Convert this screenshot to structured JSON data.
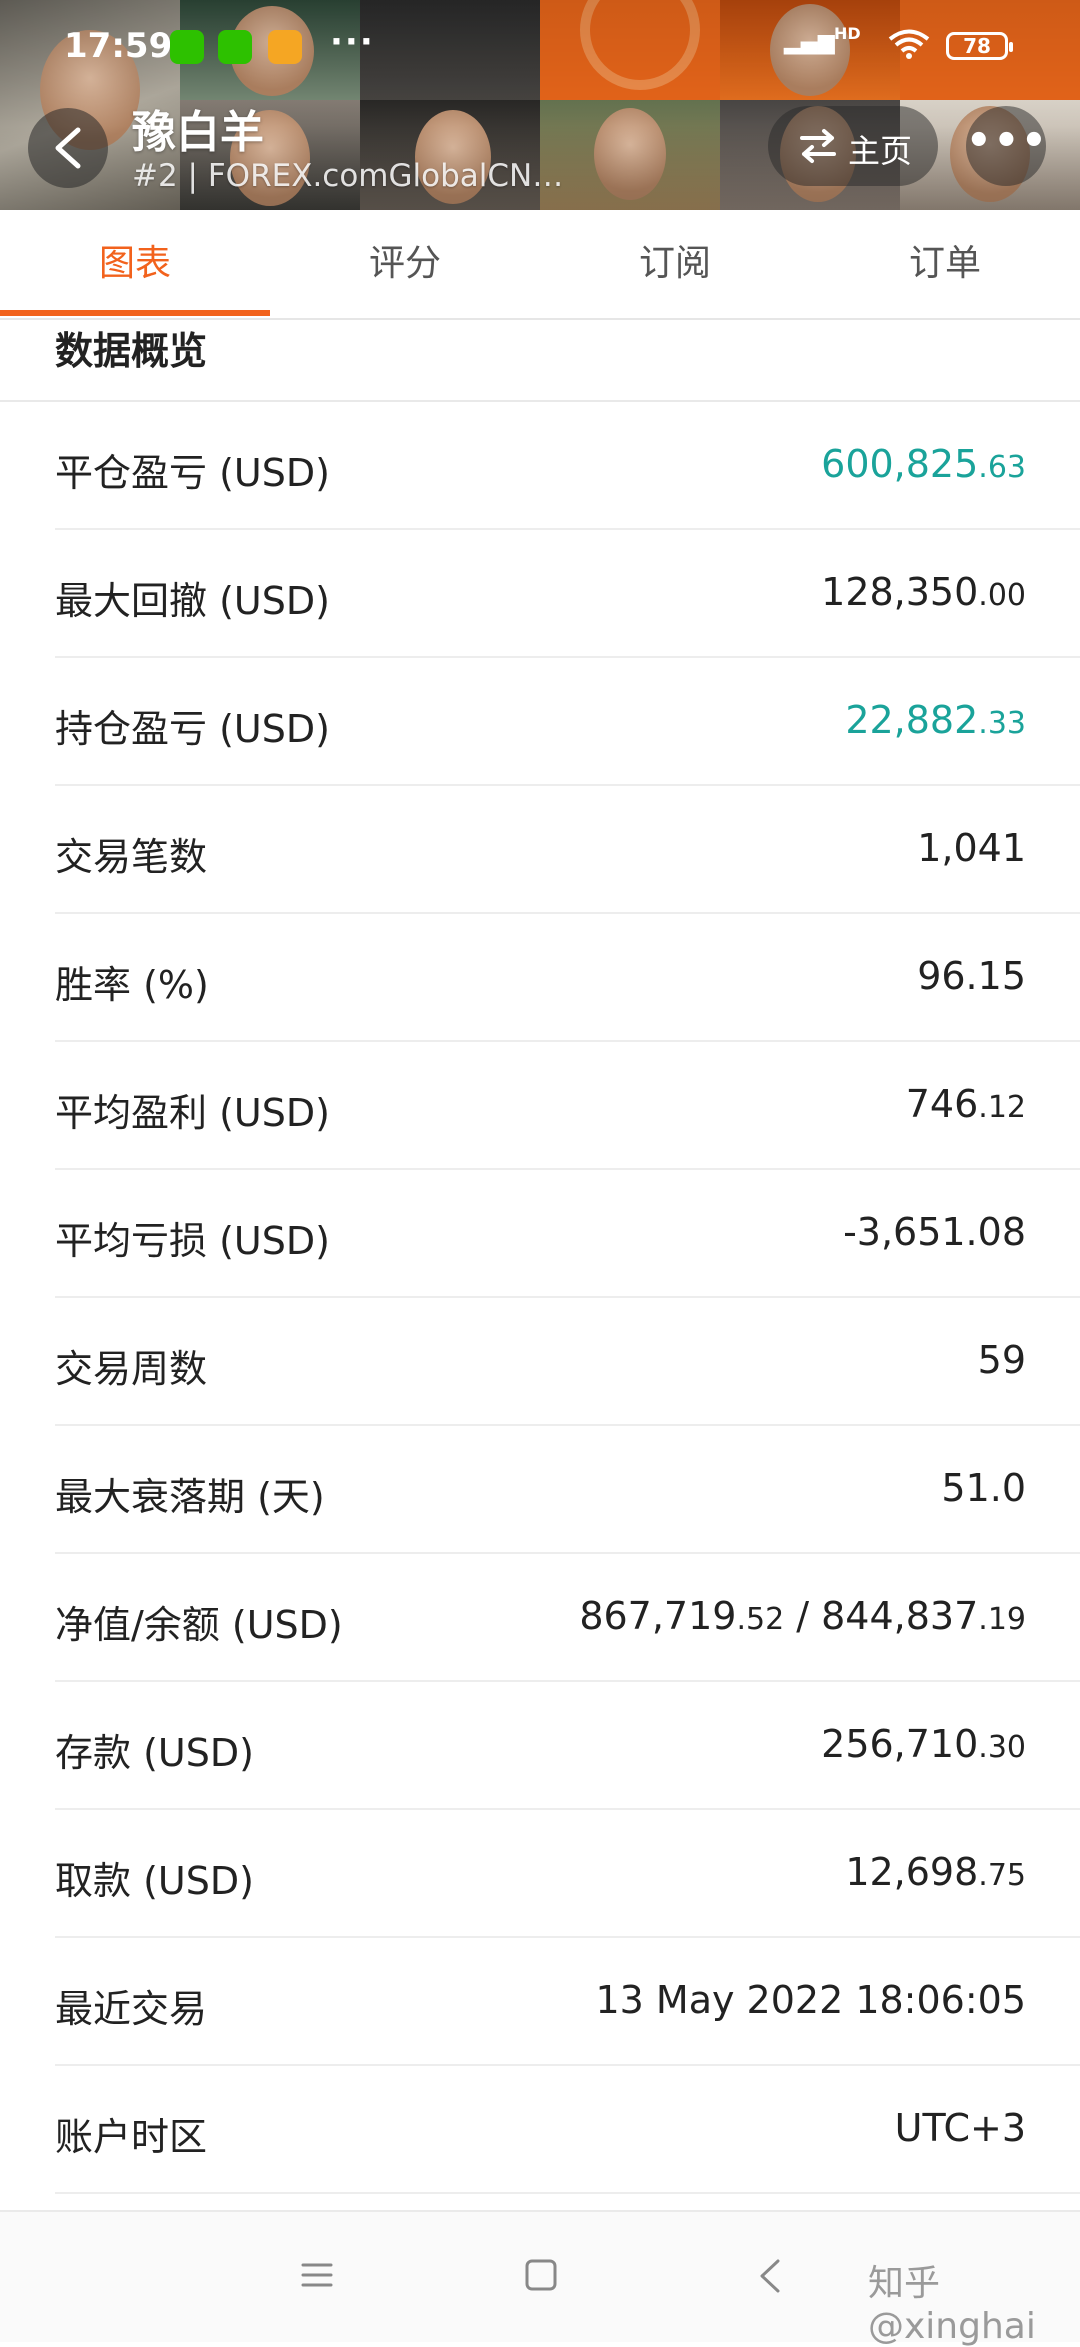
{
  "status_bar": {
    "time": "17:59",
    "more": "···",
    "signal_label": "HD",
    "battery": "78"
  },
  "header": {
    "title": "豫白羊",
    "subtitle": "#2 | FOREX.comGlobalCN…",
    "home_label": "主页",
    "more": "•••"
  },
  "tabs": [
    {
      "label": "图表",
      "active": true
    },
    {
      "label": "评分",
      "active": false
    },
    {
      "label": "订阅",
      "active": false
    },
    {
      "label": "订单",
      "active": false
    }
  ],
  "section": {
    "title": "数据概览"
  },
  "stats": [
    {
      "label": "平仓盈亏 (USD)",
      "int": "600,825",
      "dec": ".63",
      "positive": true
    },
    {
      "label": "最大回撤 (USD)",
      "int": "128,350",
      "dec": ".00",
      "positive": false
    },
    {
      "label": "持仓盈亏 (USD)",
      "int": "22,882",
      "dec": ".33",
      "positive": true
    },
    {
      "label": "交易笔数",
      "int": "1,041",
      "dec": "",
      "positive": false
    },
    {
      "label": "胜率 (%)",
      "int": "96.15",
      "dec": "",
      "positive": false
    },
    {
      "label": "平均盈利 (USD)",
      "int": "746",
      "dec": ".12",
      "positive": false
    },
    {
      "label": "平均亏损 (USD)",
      "int": "-3,651.08",
      "dec": "",
      "positive": false
    },
    {
      "label": "交易周数",
      "int": "59",
      "dec": "",
      "positive": false
    },
    {
      "label": "最大衰落期 (天)",
      "int": "51.0",
      "dec": "",
      "positive": false
    },
    {
      "label": "净值/余额 (USD)",
      "int": "867,719",
      "dec": ".52",
      "int2": " / 844,837",
      "dec2": ".19",
      "positive": false
    },
    {
      "label": "存款 (USD)",
      "int": "256,710",
      "dec": ".30",
      "positive": false
    },
    {
      "label": "取款 (USD)",
      "int": "12,698",
      "dec": ".75",
      "positive": false
    },
    {
      "label": "最近交易",
      "int": "13 May 2022 18:06:05",
      "dec": "",
      "positive": false
    },
    {
      "label": "账户时区",
      "int": "UTC+3",
      "dec": "",
      "positive": false
    }
  ],
  "watermark": "知乎 @xinghai",
  "colors": {
    "accent": "#f2621c",
    "positive": "#1aa39a"
  }
}
